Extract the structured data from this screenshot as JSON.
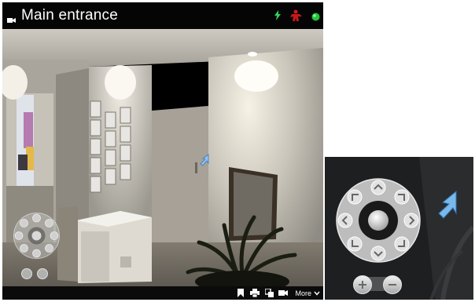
{
  "window": {
    "title": "Main entrance",
    "icon": "camera-icon"
  },
  "status": {
    "icons": [
      "lightning-icon",
      "event-alert-icon",
      "live-status-icon"
    ],
    "colors": {
      "lightning": "#2ed35f",
      "alert": "#d3191a",
      "live": "#22c53a"
    }
  },
  "toolbar": {
    "icons": [
      "bookmark-icon",
      "print-icon",
      "copy-icon",
      "record-icon"
    ],
    "more_label": "More"
  },
  "ptz": {
    "icons": [
      "pan-up-icon",
      "pan-down-icon",
      "pan-left-icon",
      "pan-right-icon",
      "pan-up-left-icon",
      "pan-up-right-icon",
      "pan-down-left-icon",
      "pan-down-right-icon",
      "home-icon",
      "zoom-in-icon",
      "zoom-out-icon"
    ]
  }
}
